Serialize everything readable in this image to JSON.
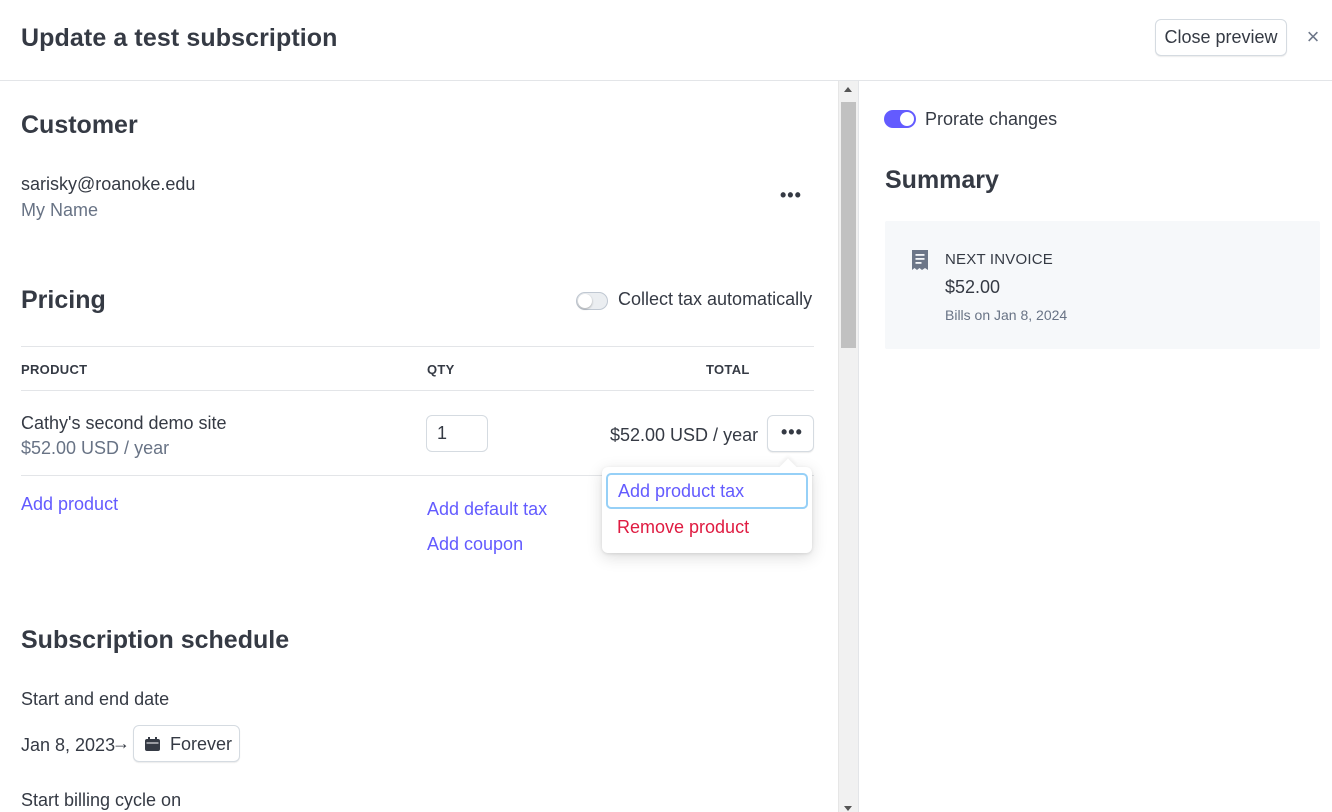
{
  "header": {
    "title": "Update a test subscription",
    "close_preview_label": "Close preview",
    "close_icon": "×"
  },
  "customer": {
    "title": "Customer",
    "email": "sarisky@roanoke.edu",
    "name": "My Name",
    "menu_icon": "•••"
  },
  "pricing": {
    "title": "Pricing",
    "collect_tax_label": "Collect tax automatically",
    "collect_tax_on": false,
    "columns": {
      "product": "PRODUCT",
      "qty": "QTY",
      "total": "TOTAL"
    },
    "rows": [
      {
        "product_name": "Cathy's second demo site",
        "product_price": "$52.00 USD / year",
        "qty": "1",
        "total": "$52.00 USD / year",
        "menu_icon": "•••"
      }
    ],
    "add_product": "Add product",
    "add_default_tax": "Add default tax",
    "add_coupon": "Add coupon",
    "row_menu": {
      "add_product_tax": "Add product tax",
      "remove_product": "Remove product"
    }
  },
  "schedule": {
    "title": "Subscription schedule",
    "start_end_label": "Start and end date",
    "start_date": "Jan 8, 2023",
    "arrow": "→",
    "end_label": "Forever",
    "billing_cycle_label": "Start billing cycle on"
  },
  "summary": {
    "prorate_label": "Prorate changes",
    "prorate_on": true,
    "title": "Summary",
    "next_invoice_label": "NEXT INVOICE",
    "next_invoice_amount": "$52.00",
    "bills_on": "Bills on Jan 8, 2024",
    "invoice_icon": "receipt-icon"
  },
  "colors": {
    "accent": "#635bff",
    "danger": "#df1b41",
    "text": "#353a44",
    "muted": "#687385",
    "focus_ring": "#96d0f7"
  }
}
